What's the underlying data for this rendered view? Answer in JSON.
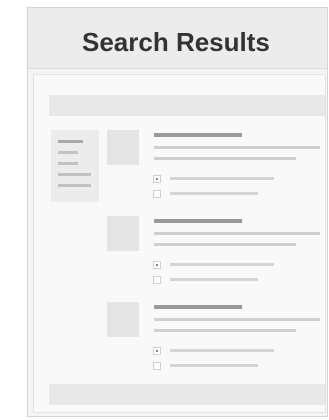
{
  "header": {
    "title": "Search Results"
  },
  "filters": {
    "option_count": 4
  },
  "results": [
    {
      "checkbox_top_checked": true,
      "checkbox_bottom_checked": false
    },
    {
      "checkbox_top_checked": true,
      "checkbox_bottom_checked": false
    },
    {
      "checkbox_top_checked": true,
      "checkbox_bottom_checked": false
    }
  ],
  "colors": {
    "background": "#f4f4f4",
    "header": "#ececec",
    "placeholder_dark": "#9a9a9a",
    "placeholder_light": "#cfcfcf"
  }
}
